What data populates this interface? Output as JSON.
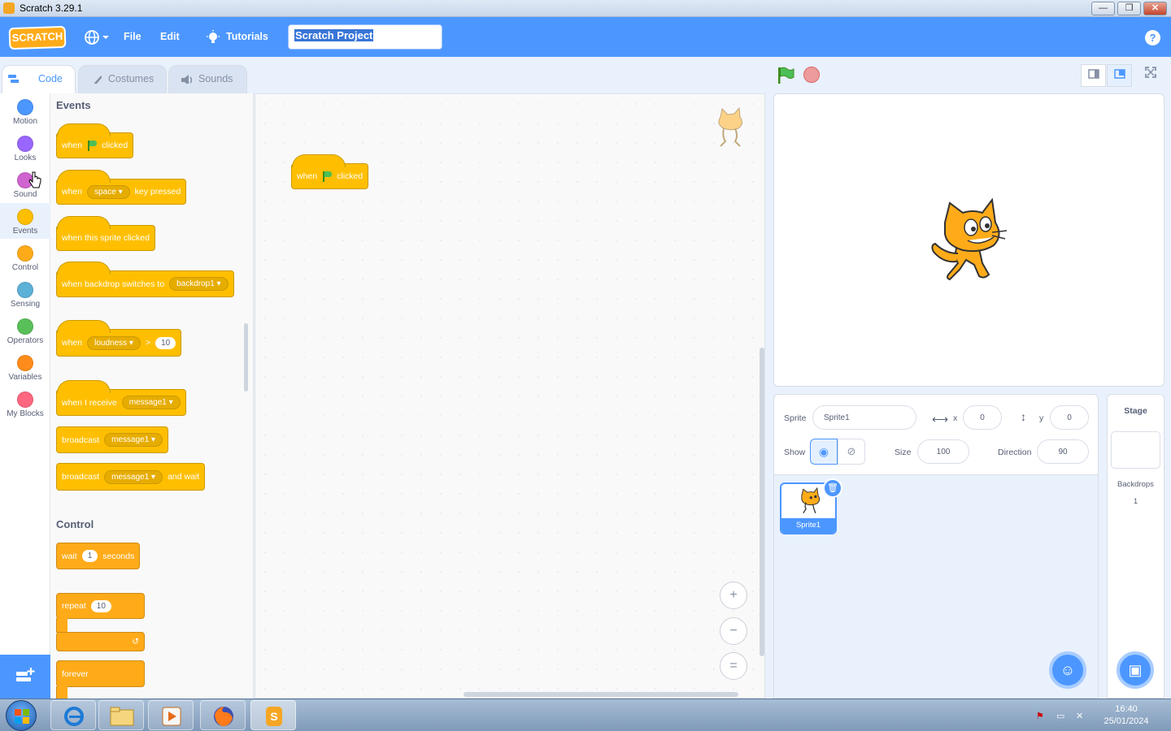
{
  "window": {
    "title": "Scratch 3.29.1",
    "min": "—",
    "max": "❐",
    "close": "✕"
  },
  "menubar": {
    "logo": "SCRATCH",
    "file": "File",
    "edit": "Edit",
    "tutorials": "Tutorials",
    "project_title": "Scratch Project"
  },
  "tabs": [
    {
      "label": "Code",
      "active": true
    },
    {
      "label": "Costumes",
      "active": false
    },
    {
      "label": "Sounds",
      "active": false
    }
  ],
  "categories": [
    {
      "label": "Motion",
      "color": "#4c97ff"
    },
    {
      "label": "Looks",
      "color": "#9966ff"
    },
    {
      "label": "Sound",
      "color": "#cf63cf"
    },
    {
      "label": "Events",
      "color": "#ffbf00"
    },
    {
      "label": "Control",
      "color": "#ffab19"
    },
    {
      "label": "Sensing",
      "color": "#5cb1d6"
    },
    {
      "label": "Operators",
      "color": "#59c059"
    },
    {
      "label": "Variables",
      "color": "#ff8c1a"
    },
    {
      "label": "My Blocks",
      "color": "#ff6680"
    }
  ],
  "palette": {
    "events_heading": "Events",
    "control_heading": "Control",
    "blocks": {
      "when": "when",
      "clicked": "clicked",
      "space": "space",
      "key_pressed": "key pressed",
      "when_sprite_clicked": "when this sprite clicked",
      "when_backdrop_switches": "when backdrop switches to",
      "backdrop1": "backdrop1",
      "loudness": "loudness",
      "gt": ">",
      "ten": "10",
      "when_i_receive": "when I receive",
      "message1": "message1",
      "broadcast": "broadcast",
      "and_wait": "and wait",
      "wait": "wait",
      "one": "1",
      "seconds": "seconds",
      "repeat": "repeat",
      "forever": "forever"
    }
  },
  "script": {
    "when": "when",
    "clicked": "clicked"
  },
  "zoom": {
    "in": "+",
    "out": "−",
    "reset": "="
  },
  "sprite_info": {
    "sprite_label": "Sprite",
    "sprite_name": "Sprite1",
    "x_label": "x",
    "x_value": "0",
    "y_label": "y",
    "y_value": "0",
    "show_label": "Show",
    "size_label": "Size",
    "size_value": "100",
    "direction_label": "Direction",
    "direction_value": "90"
  },
  "sprite_list": [
    {
      "name": "Sprite1",
      "selected": true
    }
  ],
  "stage_pane": {
    "heading": "Stage",
    "backdrops_label": "Backdrops",
    "backdrops_count": "1"
  },
  "taskbar": {
    "time": "16:40",
    "date": "25/01/2024"
  },
  "colors": {
    "accent": "#4c97ff",
    "events": "#ffbf00",
    "control": "#ffab19"
  }
}
